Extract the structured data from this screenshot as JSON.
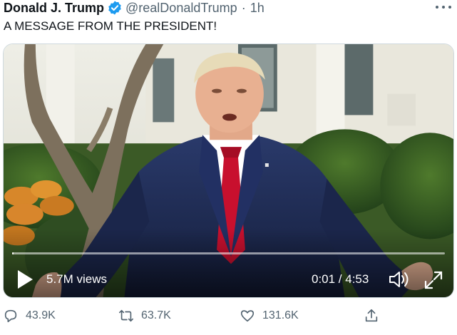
{
  "tweet": {
    "author_name": "Donald J. Trump",
    "verified_icon": "verified-badge-icon",
    "handle": "@realDonaldTrump",
    "separator": "·",
    "timestamp": "1h",
    "more_icon": "more-options-icon",
    "text": "A MESSAGE FROM THE PRESIDENT!"
  },
  "video": {
    "views": "5.7M views",
    "timecode": "0:01 / 4:53",
    "progress_fraction": 0.004,
    "play_icon": "play-icon",
    "volume_icon": "volume-icon",
    "fullscreen_icon": "fullscreen-icon"
  },
  "actions": {
    "reply_count": "43.9K",
    "retweet_count": "63.7K",
    "like_count": "131.6K",
    "reply_icon": "reply-icon",
    "retweet_icon": "retweet-icon",
    "like_icon": "like-icon",
    "share_icon": "share-icon"
  },
  "colors": {
    "verified_blue": "#1d9bf0",
    "secondary_text": "#536471",
    "suit_navy": "#1e2a52",
    "tie_red": "#c8102e"
  }
}
